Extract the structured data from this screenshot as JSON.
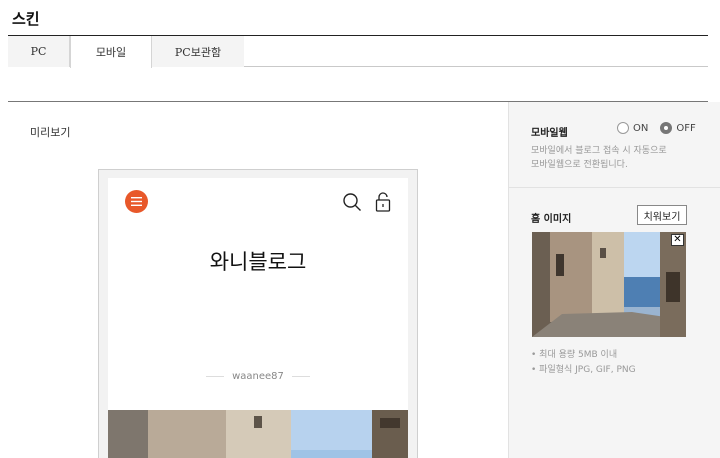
{
  "page": {
    "title": "스킨"
  },
  "tabs": [
    {
      "label": "PC",
      "active": false
    },
    {
      "label": "모바일",
      "active": true
    },
    {
      "label": "PC보관함",
      "active": false
    }
  ],
  "preview": {
    "label": "미리보기",
    "blog_title": "와니블로그",
    "blog_user": "waanee87",
    "accent_color": "#e8582a",
    "icons": [
      "menu-icon",
      "search-icon",
      "lock-icon"
    ]
  },
  "mobile_web": {
    "label": "모바일웹",
    "options": [
      {
        "label": "ON",
        "selected": false
      },
      {
        "label": "OFF",
        "selected": true
      }
    ],
    "description": [
      "모바일에서 블로그 접속 시 자동으로",
      "모바일웹으로 전환됩니다."
    ]
  },
  "home_image": {
    "label": "홈 이미지",
    "remove_button": "치워보기",
    "close_symbol": "✕",
    "notes": [
      "최대 용량 5MB 이내",
      "파일형식 JPG, GIF, PNG"
    ]
  }
}
